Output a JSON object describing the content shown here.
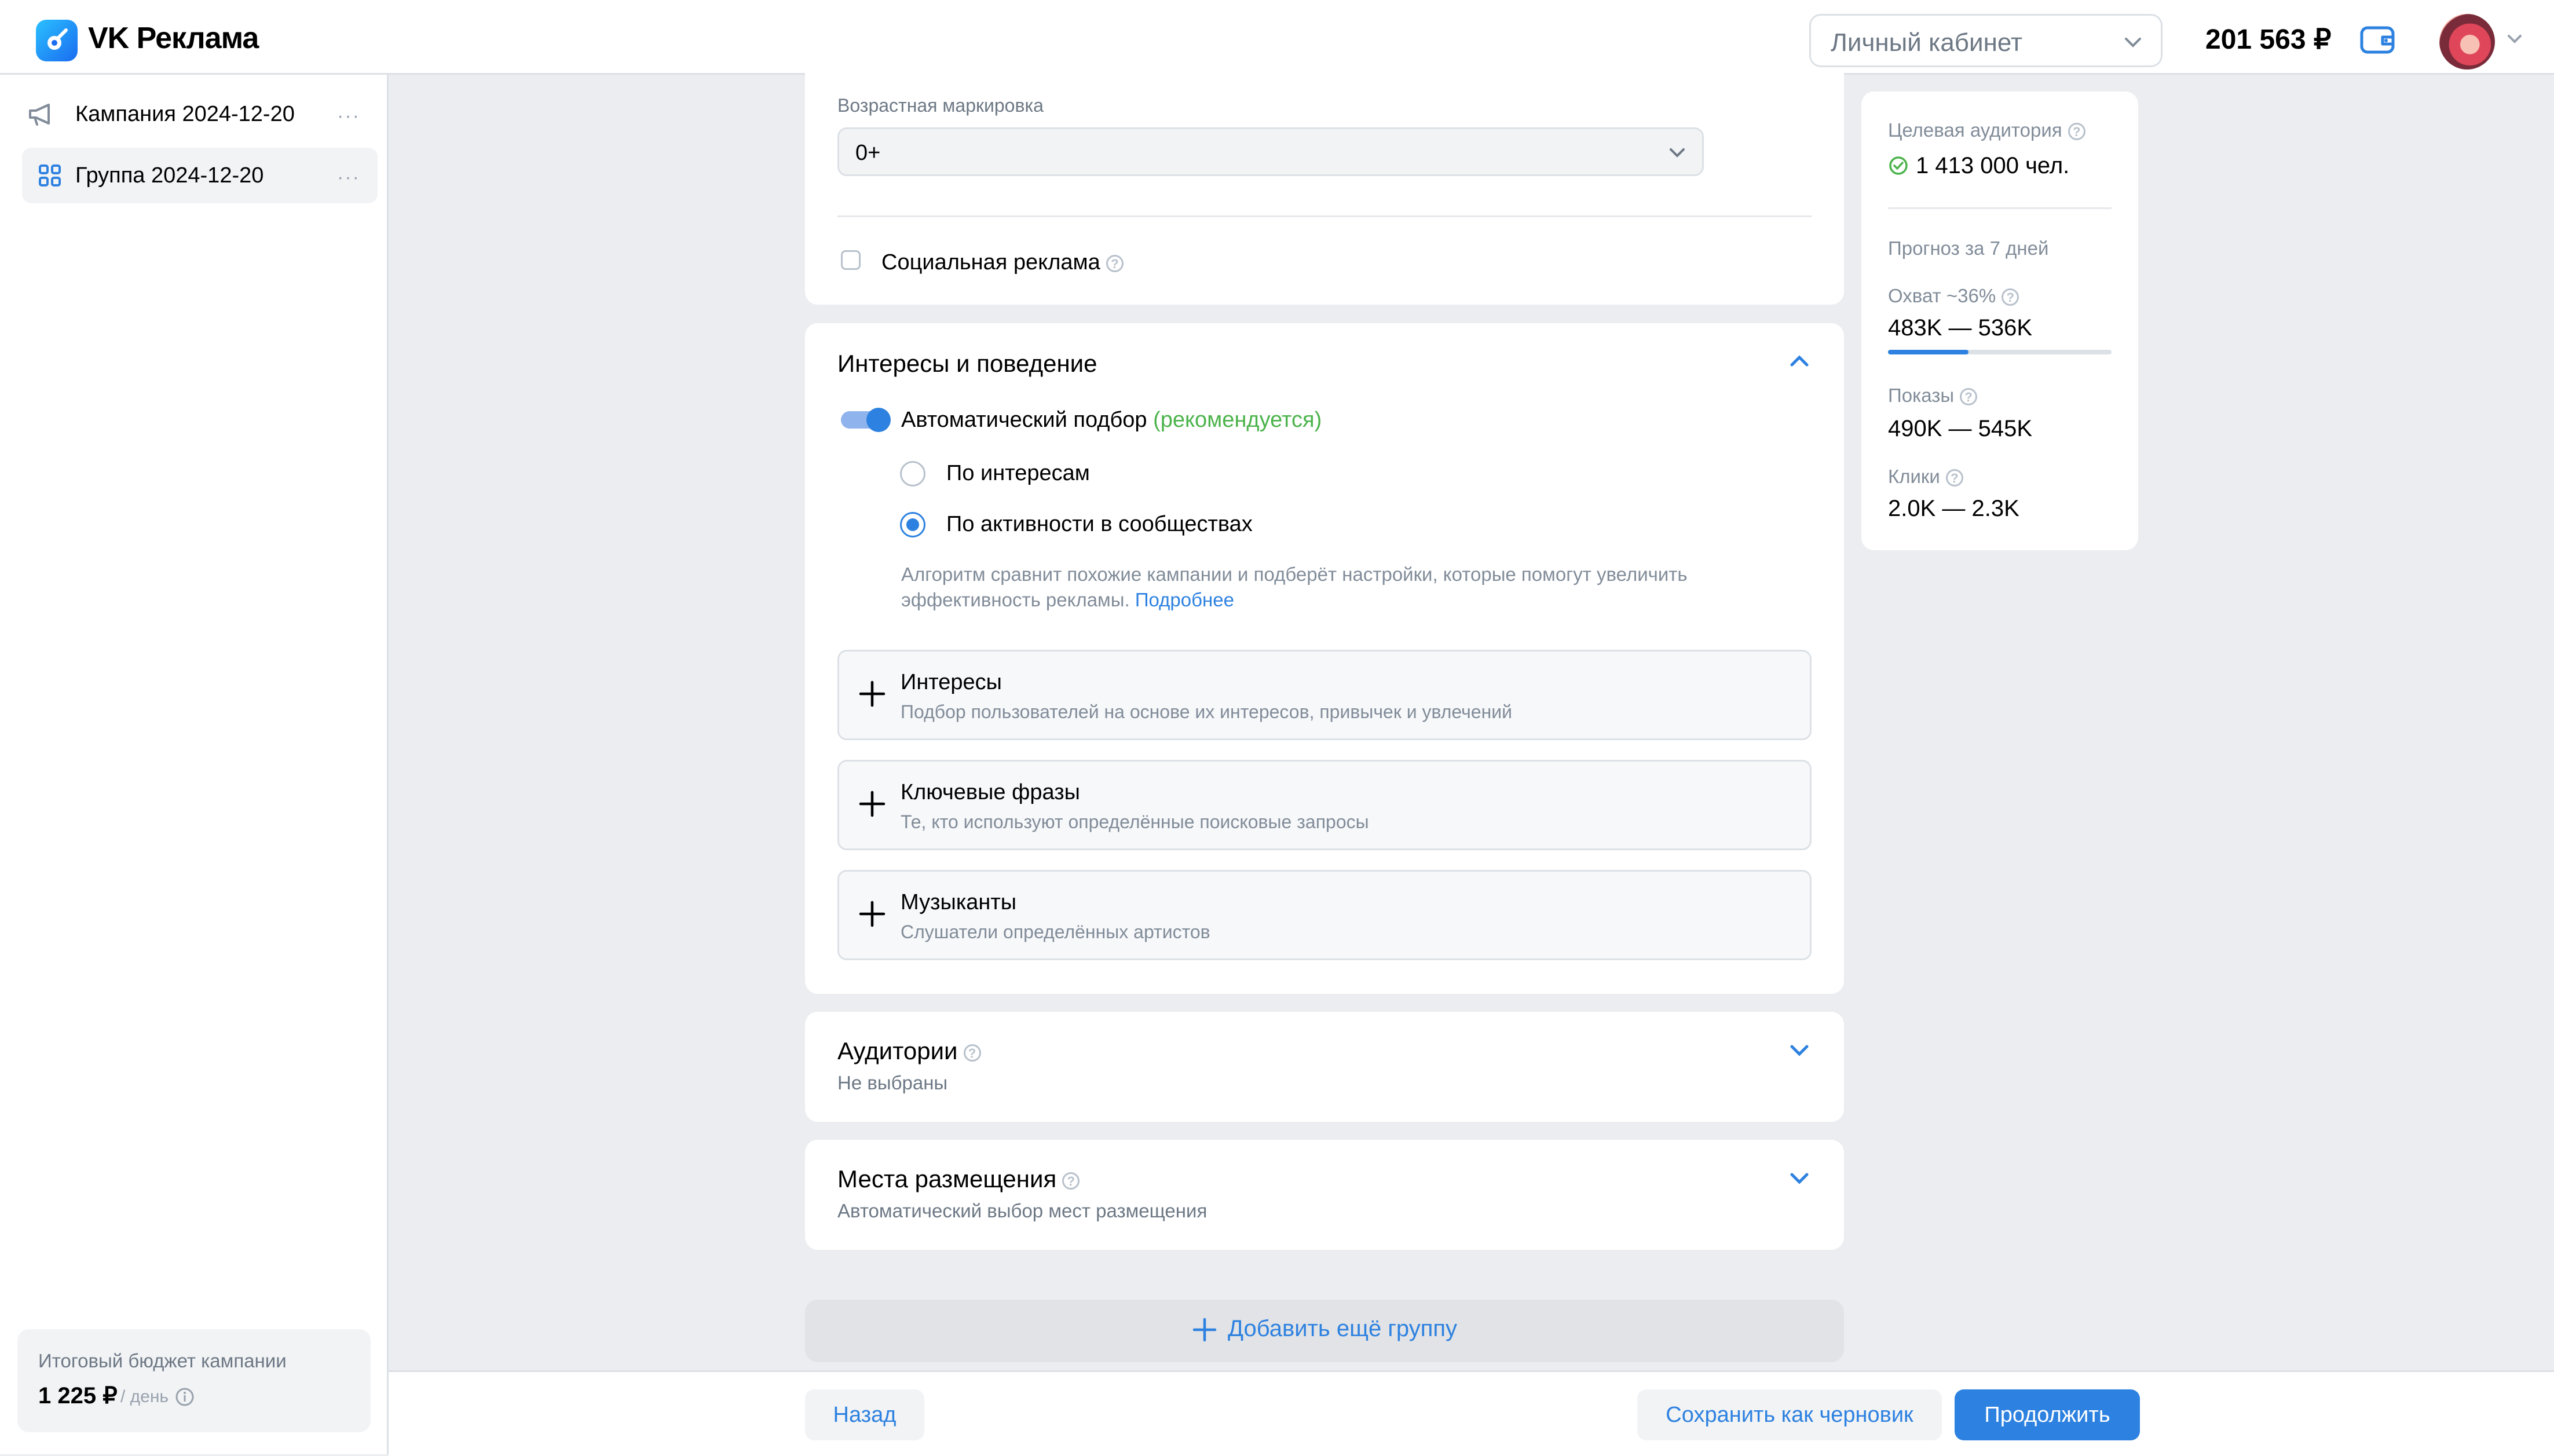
{
  "header": {
    "logo_text": "VK Реклама",
    "cabinet_label": "Личный кабинет",
    "balance": "201 563 ₽"
  },
  "sidebar": {
    "items": [
      {
        "label": "Кампания 2024-12-20",
        "more": "···",
        "icon": "megaphone-icon"
      },
      {
        "label": "Группа 2024-12-20",
        "more": "···",
        "icon": "grid-icon"
      }
    ],
    "budget": {
      "title": "Итоговый бюджет кампании",
      "value": "1 225 ₽",
      "unit": "/ день"
    }
  },
  "age_section": {
    "label": "Возрастная маркировка",
    "value": "0+",
    "social_ad_label": "Социальная реклама"
  },
  "interests_section": {
    "title": "Интересы и поведение",
    "auto_label": "Автоматический подбор",
    "auto_recommended": "(рекомендуется)",
    "radio_options": [
      {
        "label": "По интересам",
        "selected": false
      },
      {
        "label": "По активности в сообществах",
        "selected": true
      }
    ],
    "algo_text": "Алгоритм сравнит похожие кампании и подберёт настройки, которые помогут увеличить эффективность рекламы.",
    "algo_link": "Подробнее",
    "add_boxes": [
      {
        "title": "Интересы",
        "subtitle": "Подбор пользователей на основе их интересов, привычек и увлечений"
      },
      {
        "title": "Ключевые фразы",
        "subtitle": "Те, кто используют определённые поисковые запросы"
      },
      {
        "title": "Музыканты",
        "subtitle": "Слушатели определённых артистов"
      }
    ]
  },
  "audiences_section": {
    "title": "Аудитории",
    "subtitle": "Не выбраны"
  },
  "placements_section": {
    "title": "Места размещения",
    "subtitle": "Автоматический выбор мест размещения"
  },
  "add_group_label": "Добавить ещё группу",
  "forecast": {
    "target_label": "Целевая аудитория",
    "target_value": "1 413 000 чел.",
    "period_label": "Прогноз за 7 дней",
    "reach_label": "Охват ~36%",
    "reach_value": "483K — 536K",
    "reach_fraction": 0.36,
    "impressions_label": "Показы",
    "impressions_value": "490K — 545K",
    "clicks_label": "Клики",
    "clicks_value": "2.0K — 2.3K"
  },
  "footer": {
    "back_label": "Назад",
    "draft_label": "Сохранить как черновик",
    "next_label": "Продолжить"
  },
  "colors": {
    "accent": "#2d81e0",
    "success": "#4bb34b",
    "background": "#ebedf0"
  }
}
